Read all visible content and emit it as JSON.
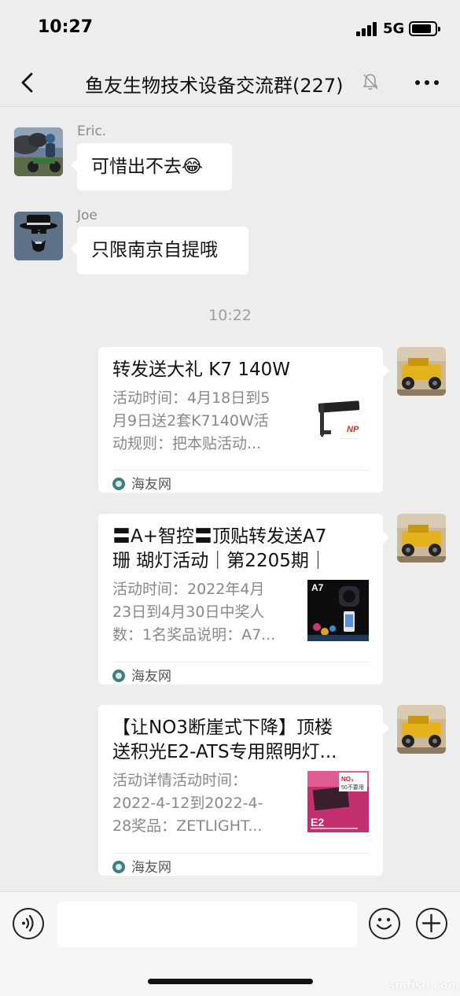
{
  "status_bar": {
    "time": "10:27",
    "network": "5G"
  },
  "nav": {
    "title": "鱼友生物技术设备交流群(227)"
  },
  "messages": [
    {
      "sender": "Eric.",
      "text": "可惜出不去😂"
    },
    {
      "sender": "Joe",
      "text": "只限南京自提哦"
    }
  ],
  "timestamp": "10:22",
  "cards": [
    {
      "title": "转发送大礼 K7 140W",
      "desc": [
        "活动时间：4月18日到5",
        "月9日送2套K7140W活",
        "动规则：把本贴活动..."
      ],
      "source": "海友网"
    },
    {
      "title": [
        "〓A+智控〓顶贴转发送A7",
        "珊 瑚灯活动｜第2205期｜"
      ],
      "desc": [
        "活动时间：2022年4月",
        "23日到4月30日中奖人",
        "数：1名奖品说明：A7..."
      ],
      "thumb_label": "A7",
      "source": "海友网"
    },
    {
      "title": [
        "【让NO3断崖式下降】顶楼",
        "送积光E2-ATS专用照明灯..."
      ],
      "desc": [
        "活动详情活动时间：",
        "2022-4-12到2022-4-",
        "28奖品：ZETLIGHT..."
      ],
      "thumb_label": "NO₃ 50不要用",
      "thumb_label2": "E2",
      "source": "海友网"
    }
  ],
  "watermark": "smfish.com"
}
